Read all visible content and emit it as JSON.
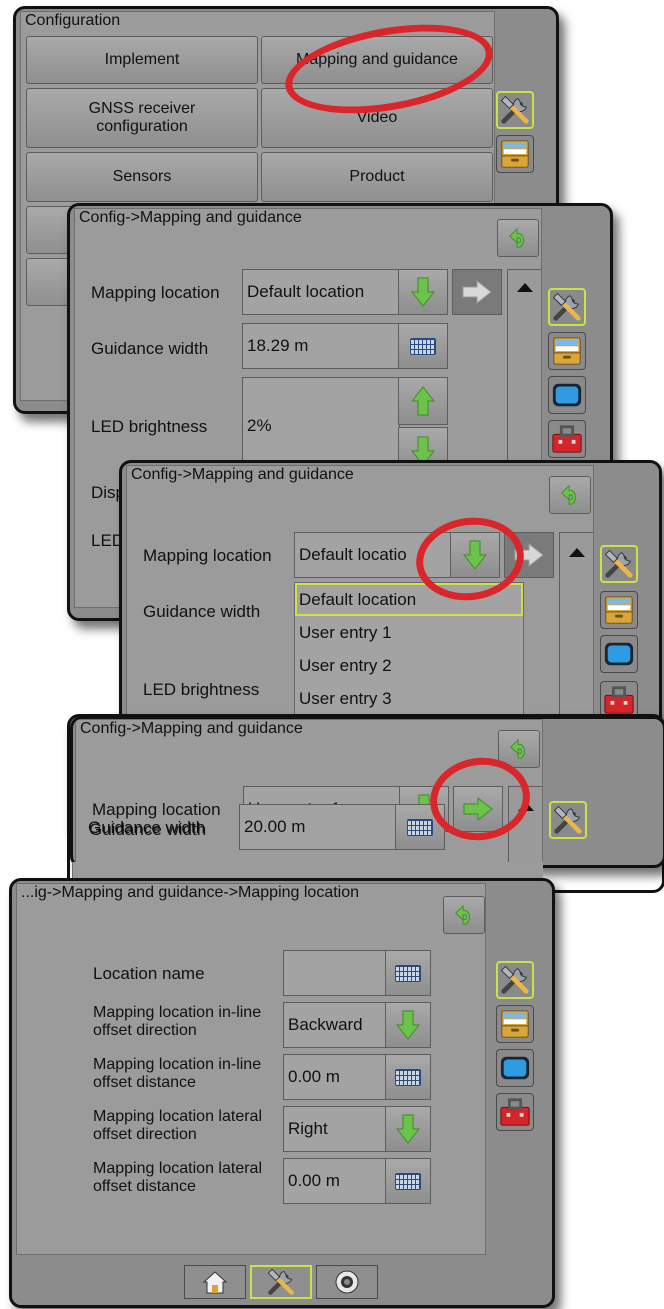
{
  "screen1": {
    "title": "Configuration",
    "buttons": [
      "Implement",
      "Mapping and guidance",
      "GNSS receiver configuration",
      "Video",
      "Sensors",
      "Product"
    ]
  },
  "screen2": {
    "title": "Config->Mapping and guidance",
    "mapping_location_label": "Mapping location",
    "mapping_location_value": "Default location",
    "guidance_width_label": "Guidance width",
    "guidance_width_value": "18.29 m",
    "led_brightness_label": "LED brightness",
    "led_brightness_value": "2%",
    "partial_label_1": "Disp",
    "partial_label_2": "LED"
  },
  "screen3": {
    "title": "Config->Mapping and guidance",
    "mapping_location_label": "Mapping location",
    "mapping_location_value": "Default locatio",
    "guidance_width_label": "Guidance width",
    "led_brightness_label": "LED brightness",
    "options": [
      "Default location",
      "User entry 1",
      "User entry 2",
      "User entry 3"
    ]
  },
  "screen4": {
    "title": "Config->Mapping and guidance",
    "mapping_location_label": "Mapping location",
    "mapping_location_value": "User entry 1",
    "guidance_width_label": "Guidance width",
    "guidance_width_value": "20.00 m"
  },
  "screen5": {
    "title": "...ig->Mapping and guidance->Mapping location",
    "location_name_label": "Location name",
    "location_name_value": "",
    "inline_dir_label": "Mapping location in-line offset direction",
    "inline_dir_value": "Backward",
    "inline_dist_label": "Mapping location in-line offset distance",
    "inline_dist_value": "0.00 m",
    "lateral_dir_label": "Mapping location lateral offset direction",
    "lateral_dir_value": "Right",
    "lateral_dist_label": "Mapping location lateral offset distance",
    "lateral_dist_value": "0.00 m"
  },
  "bottom_nav": [
    "home-icon",
    "tools-icon",
    "camera-icon"
  ],
  "colors": {
    "highlight": "#d8262b",
    "green_arrow": "#6cc24a",
    "selected_border": "#c7e34a"
  }
}
